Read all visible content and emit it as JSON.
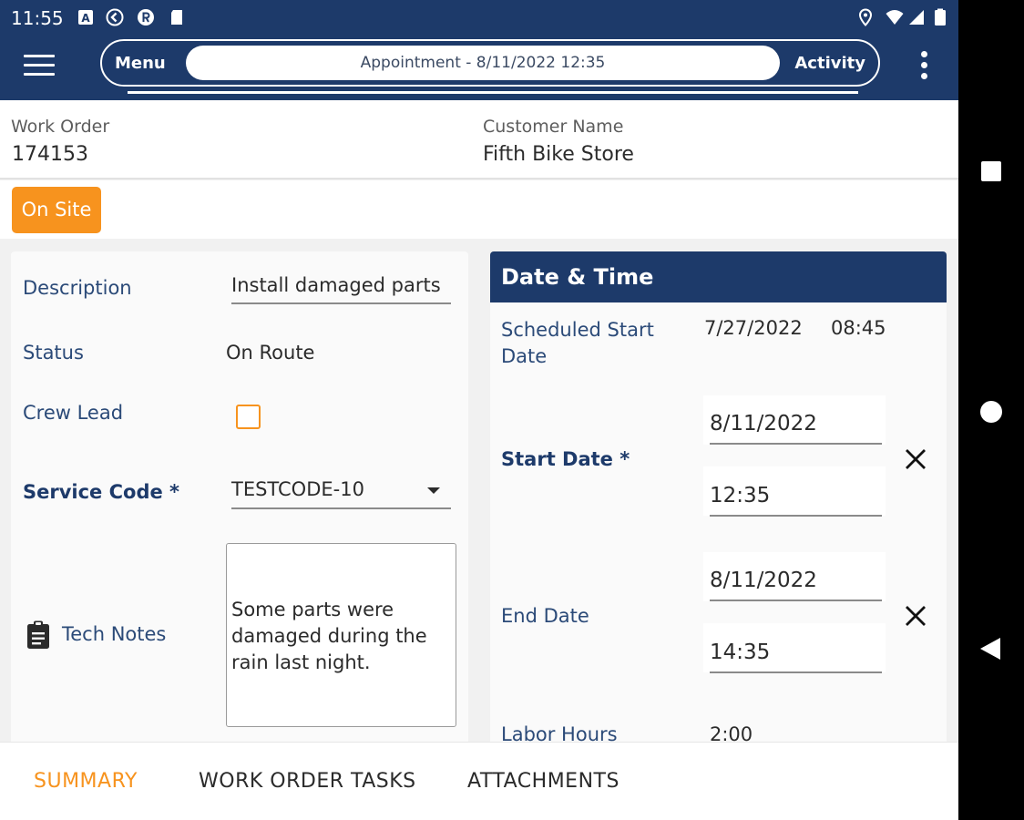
{
  "status_bar": {
    "time": "11:55",
    "icons": [
      "a-box-icon",
      "circle-back-icon",
      "circle-r-icon",
      "sd-card-icon",
      "location-icon",
      "wifi-icon",
      "signal-icon",
      "battery-icon"
    ]
  },
  "header": {
    "menu_label": "Menu",
    "center_title": "Appointment - 8/11/2022 12:35",
    "activity_label": "Activity"
  },
  "info": {
    "work_order_label": "Work Order",
    "work_order_value": "174153",
    "customer_label": "Customer Name",
    "customer_value": "Fifth Bike Store"
  },
  "status_button": "On Site",
  "details": {
    "description_label": "Description",
    "description_value": "Install damaged parts",
    "status_label": "Status",
    "status_value": "On Route",
    "crew_lead_label": "Crew Lead",
    "crew_lead_checked": false,
    "service_code_label": "Service Code *",
    "service_code_value": "TESTCODE-10",
    "tech_notes_label": "Tech Notes",
    "tech_notes_value": "Some parts were damaged during the rain last night."
  },
  "datetime": {
    "title": "Date & Time",
    "scheduled_label": "Scheduled Start Date",
    "scheduled_date": "7/27/2022",
    "scheduled_time": "08:45",
    "start_label": "Start Date *",
    "start_date": "8/11/2022",
    "start_time": "12:35",
    "end_label": "End Date",
    "end_date": "8/11/2022",
    "end_time": "14:35",
    "labor_label": "Labor Hours",
    "labor_value": "2:00"
  },
  "tabs": [
    {
      "label": "SUMMARY",
      "active": true
    },
    {
      "label": "WORK ORDER TASKS",
      "active": false
    },
    {
      "label": "ATTACHMENTS",
      "active": false
    }
  ],
  "colors": {
    "primary": "#1d3a6a",
    "accent": "#f7931e",
    "background": "#f1f1f1"
  }
}
